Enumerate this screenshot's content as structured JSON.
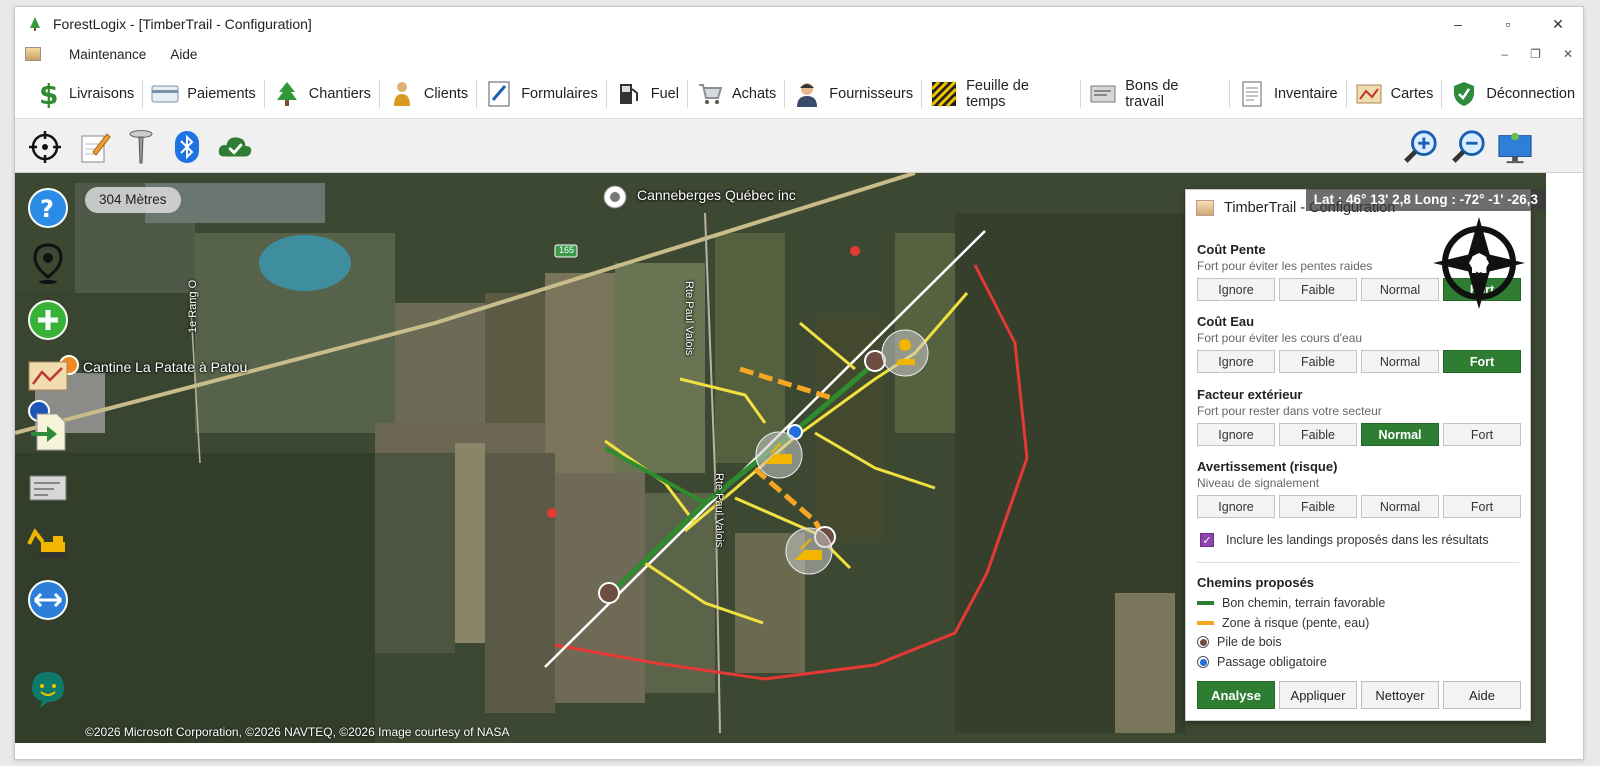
{
  "window": {
    "title": "ForestLogix - [TimberTrail - Configuration]",
    "min": "–",
    "max": "▫",
    "close": "✕"
  },
  "menu": {
    "items": [
      "Maintenance",
      "Aide"
    ],
    "mdi_min": "–",
    "mdi_restore": "❐",
    "mdi_close": "✕"
  },
  "nav": {
    "items": [
      {
        "label": "Livraisons",
        "icon": "dollar-icon"
      },
      {
        "label": "Paiements",
        "icon": "credit-card-icon"
      },
      {
        "label": "Chantiers",
        "icon": "tree-icon"
      },
      {
        "label": "Clients",
        "icon": "person-icon"
      },
      {
        "label": "Formulaires",
        "icon": "form-icon"
      },
      {
        "label": "Fuel",
        "icon": "fuel-pump-icon"
      },
      {
        "label": "Achats",
        "icon": "cart-icon"
      },
      {
        "label": "Fournisseurs",
        "icon": "supplier-icon"
      },
      {
        "label": "Feuille de temps",
        "icon": "timesheet-icon"
      },
      {
        "label": "Bons de travail",
        "icon": "work-order-icon"
      },
      {
        "label": "Inventaire",
        "icon": "inventory-icon"
      },
      {
        "label": "Cartes",
        "icon": "map-icon"
      },
      {
        "label": "Déconnection",
        "icon": "shield-check-icon"
      }
    ]
  },
  "map": {
    "scale": "304 Mètres",
    "coords": "Lat : 46° 13' 2,8 Long : -72° -1' -26,3",
    "pois": [
      "Canneberges Québec inc",
      "Cantine La Patate à Patou"
    ],
    "road_labels": [
      "Rte Paul Valois",
      "Rte Paul Valois",
      "1e Rang O"
    ],
    "highway": "165",
    "copyright": "©2026 Microsoft Corporation, ©2026 NAVTEQ, ©2026 Image courtesy of NASA",
    "compass": "N"
  },
  "panel": {
    "title": "TimberTrail - Configuration",
    "sections": [
      {
        "title": "Coût Pente",
        "sub": "Fort pour éviter les pentes raides",
        "options": [
          "Ignore",
          "Faible",
          "Normal",
          "Fort"
        ],
        "selected": "Fort"
      },
      {
        "title": "Coût Eau",
        "sub": "Fort pour éviter les cours d'eau",
        "options": [
          "Ignore",
          "Faible",
          "Normal",
          "Fort"
        ],
        "selected": "Fort"
      },
      {
        "title": "Facteur extérieur",
        "sub": "Fort pour rester dans votre secteur",
        "options": [
          "Ignore",
          "Faible",
          "Normal",
          "Fort"
        ],
        "selected": "Normal"
      },
      {
        "title": "Avertissement (risque)",
        "sub": "Niveau de signalement",
        "options": [
          "Ignore",
          "Faible",
          "Normal",
          "Fort"
        ],
        "selected": ""
      }
    ],
    "checkbox": {
      "label": "Inclure les landings proposés dans les résultats",
      "checked": true,
      "mark": "✓"
    },
    "legend_title": "Chemins proposés",
    "legend": [
      {
        "label": "Bon chemin, terrain favorable",
        "color": "#2e7d32"
      },
      {
        "label": "Zone à risque (pente, eau)",
        "color": "#f5a623"
      },
      {
        "label": "Pile de bois",
        "color": "#6d4c41"
      },
      {
        "label": "Passage obligatoire",
        "color": "#1e6fd9"
      }
    ],
    "buttons": [
      "Analyse",
      "Appliquer",
      "Nettoyer",
      "Aide"
    ]
  }
}
